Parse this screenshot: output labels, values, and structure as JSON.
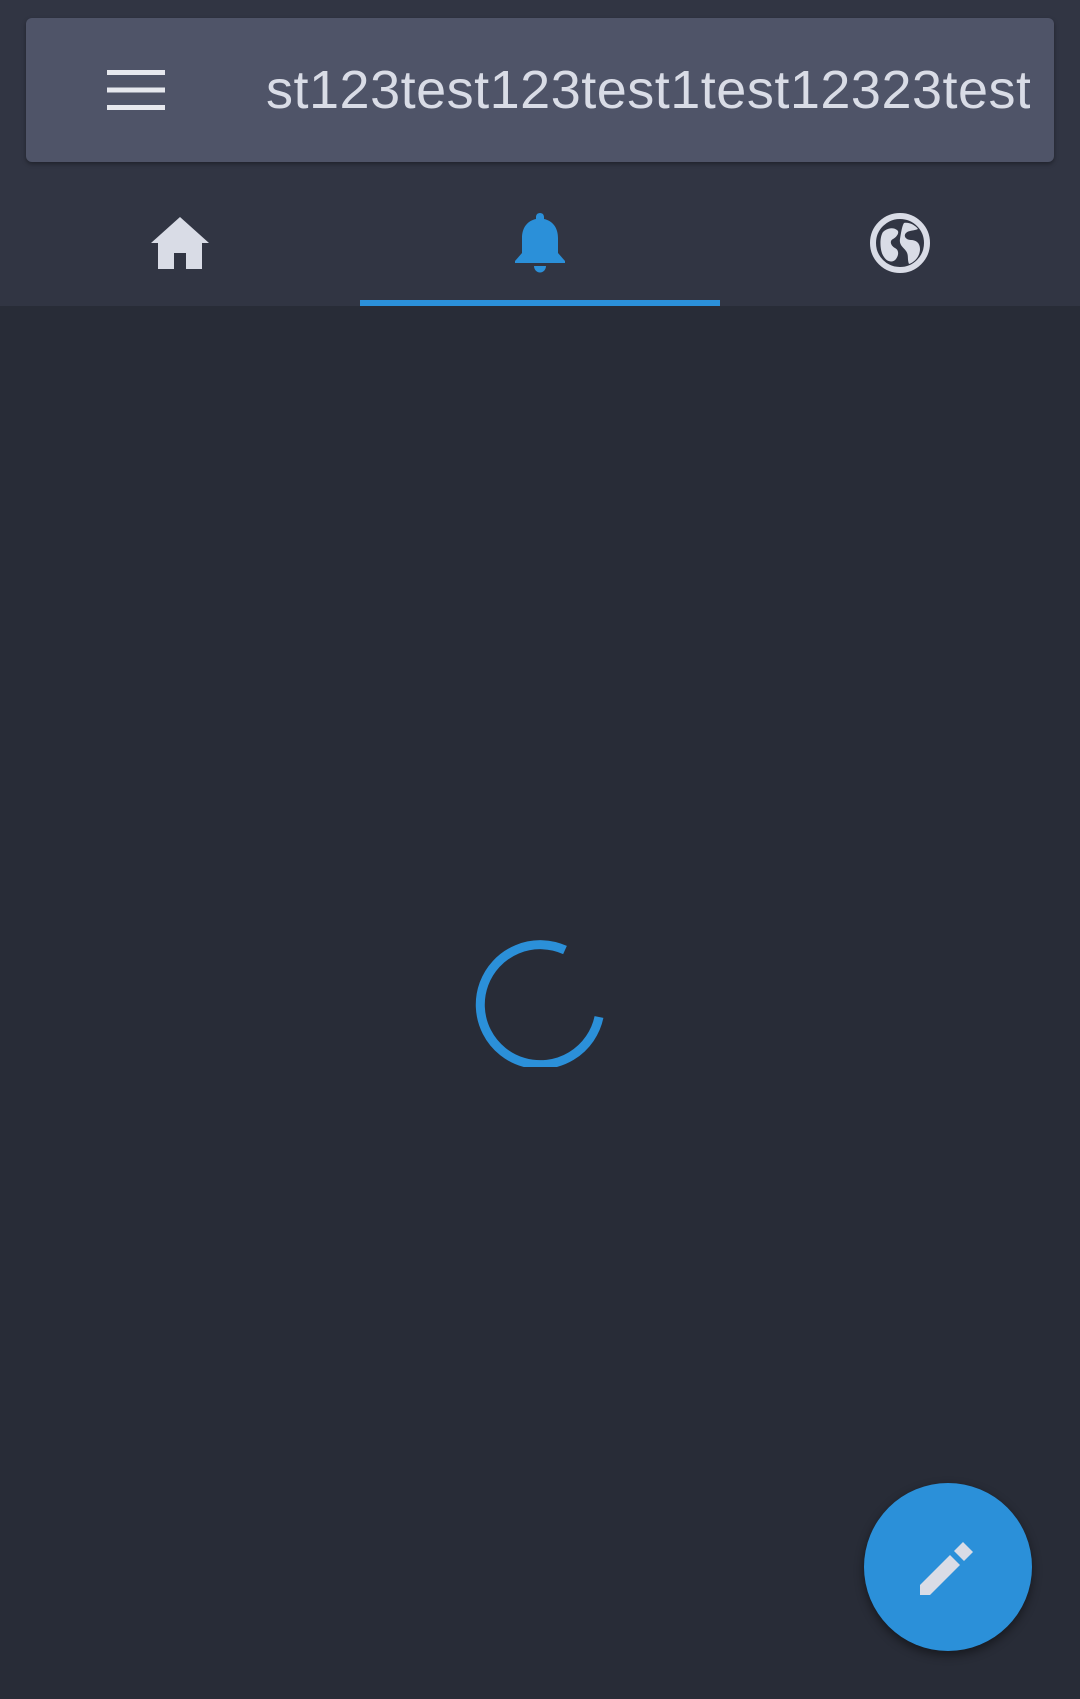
{
  "search": {
    "value": "st123test123test1test12323test"
  },
  "tabs": [
    {
      "name": "home",
      "icon": "home-icon",
      "active": false
    },
    {
      "name": "notifications",
      "icon": "bell-icon",
      "active": true
    },
    {
      "name": "federated",
      "icon": "globe-icon",
      "active": false
    }
  ],
  "colors": {
    "accent": "#2b90d9",
    "background": "#282c37",
    "tab_bar": "#313543",
    "search_bar": "#4f5468",
    "icon_inactive": "#d9dce6"
  },
  "loading": true,
  "fab": {
    "icon": "pencil-icon"
  }
}
